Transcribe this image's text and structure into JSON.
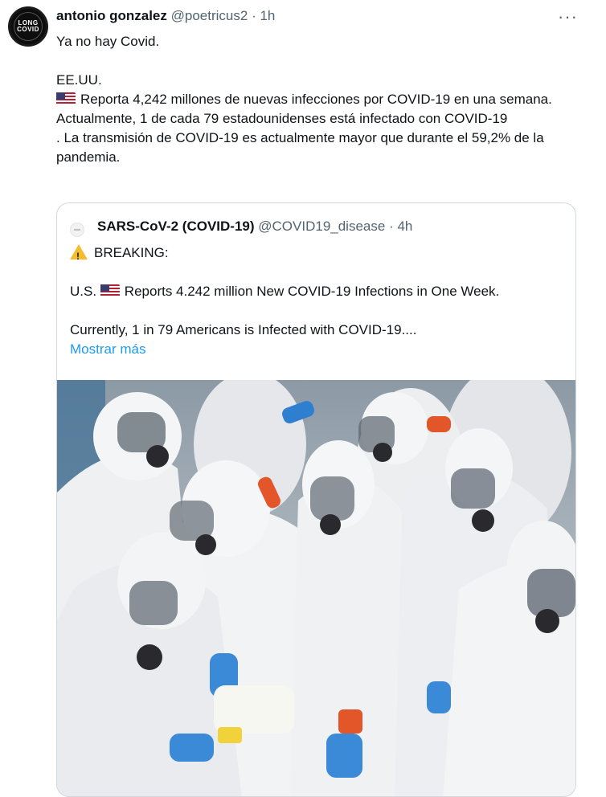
{
  "tweet": {
    "author_name": "antonio gonzalez",
    "author_handle": "@poetricus2",
    "time": "· 1h",
    "more_icon": "more-horizontal-icon",
    "avatar_text_1": "LONG",
    "avatar_text_2": "COVID",
    "line1": "Ya no hay Covid.",
    "line2": "EE.UU.",
    "line3": "Reporta 4,242 millones de nuevas infecciones por COVID-19 en una semana.",
    "line4": "Actualmente, 1 de cada 79 estadounidenses está infectado con COVID-19",
    "line5": ". La transmisión de COVID-19 es actualmente mayor que durante el 59,2% de la pandemia."
  },
  "quoted": {
    "author_name": "SARS-CoV-2 (COVID-19)",
    "author_handle": "@COVID19_disease",
    "time": "· 4h",
    "breaking": "BREAKING:",
    "line_us_prefix": "U.S.",
    "line_us": "Reports 4.242 million New COVID-19 Infections in One Week.",
    "line_current": "Currently, 1 in 79 Americans is Infected with COVID-19....",
    "show_more": "Mostrar más"
  },
  "colors": {
    "link": "#1d9bf0",
    "muted": "#536471",
    "border": "#cfd9de"
  },
  "icons": {
    "flag": "us-flag-icon",
    "warning": "warning-icon",
    "more": "more-horizontal-icon"
  }
}
